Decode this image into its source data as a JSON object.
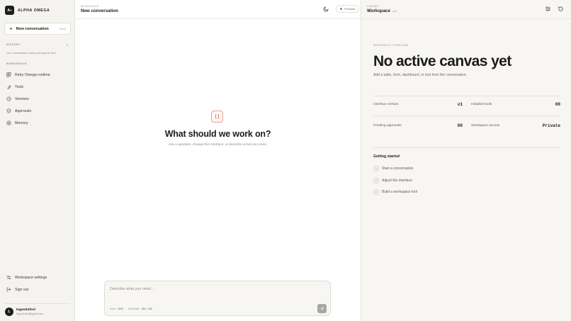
{
  "brand": {
    "logo_text": "A⌁",
    "name": "ALPHA OMEGA"
  },
  "sidebar": {
    "new_conversation": {
      "label": "New conversation",
      "shortcut": "Ctrl K"
    },
    "history": {
      "heading": "HISTORY",
      "toggle": "0",
      "empty_text": "Your conversation history will appear here"
    },
    "workspace": {
      "heading": "WORKSPACE",
      "items": [
        {
          "label": "Retry Omega runtime",
          "icon": "runtime-icon"
        },
        {
          "label": "Tools",
          "icon": "wrench-icon"
        },
        {
          "label": "Versions",
          "icon": "history-icon"
        },
        {
          "label": "Approvals",
          "icon": "shield-icon"
        },
        {
          "label": "Memory",
          "icon": "database-icon"
        }
      ]
    },
    "footer": [
      {
        "label": "Workspace settings",
        "icon": "sliders-icon"
      },
      {
        "label": "Sign out",
        "icon": "logout-icon"
      }
    ],
    "user": {
      "initial": "L",
      "name": "legendofsol",
      "email": "legendofsol@gmail.com"
    }
  },
  "main": {
    "eyebrow": "WORKSPACE",
    "title": "New conversation",
    "status": "Protected",
    "hero": {
      "title": "What should we work on?",
      "subtitle": "Ask a question, change the interface, or describe a tool you need."
    },
    "composer": {
      "placeholder": "Describe what you need...",
      "hint_enter_key": "Enter",
      "hint_send": "SEND",
      "hint_shift_key": "Shift Enter",
      "hint_newline": "NEW LINE"
    }
  },
  "canvas": {
    "eyebrow": "CANVAS",
    "title": "Workspace",
    "version": "v12",
    "overview": {
      "eyebrow": "WORKSPACE OVERVIEW",
      "title": "No active canvas yet",
      "subtitle": "Add a table, form, dashboard, or tool from the conversation.",
      "stats": [
        {
          "label": "Interface version",
          "value": "v1"
        },
        {
          "label": "Installed tools",
          "value": "00"
        },
        {
          "label": "Pending approvals",
          "value": "00"
        },
        {
          "label": "Workspace access",
          "value": "Private"
        }
      ]
    },
    "getting_started": {
      "title": "Getting started",
      "steps": [
        {
          "label": "Start a conversation"
        },
        {
          "label": "Adjust the interface"
        },
        {
          "label": "Build a workspace tool"
        }
      ]
    }
  },
  "colors": {
    "accent": "#e07a5f",
    "sidebar_bg": "#f4f3ef",
    "canvas_bg": "#f7f6f2",
    "ink": "#1c1c1a"
  }
}
